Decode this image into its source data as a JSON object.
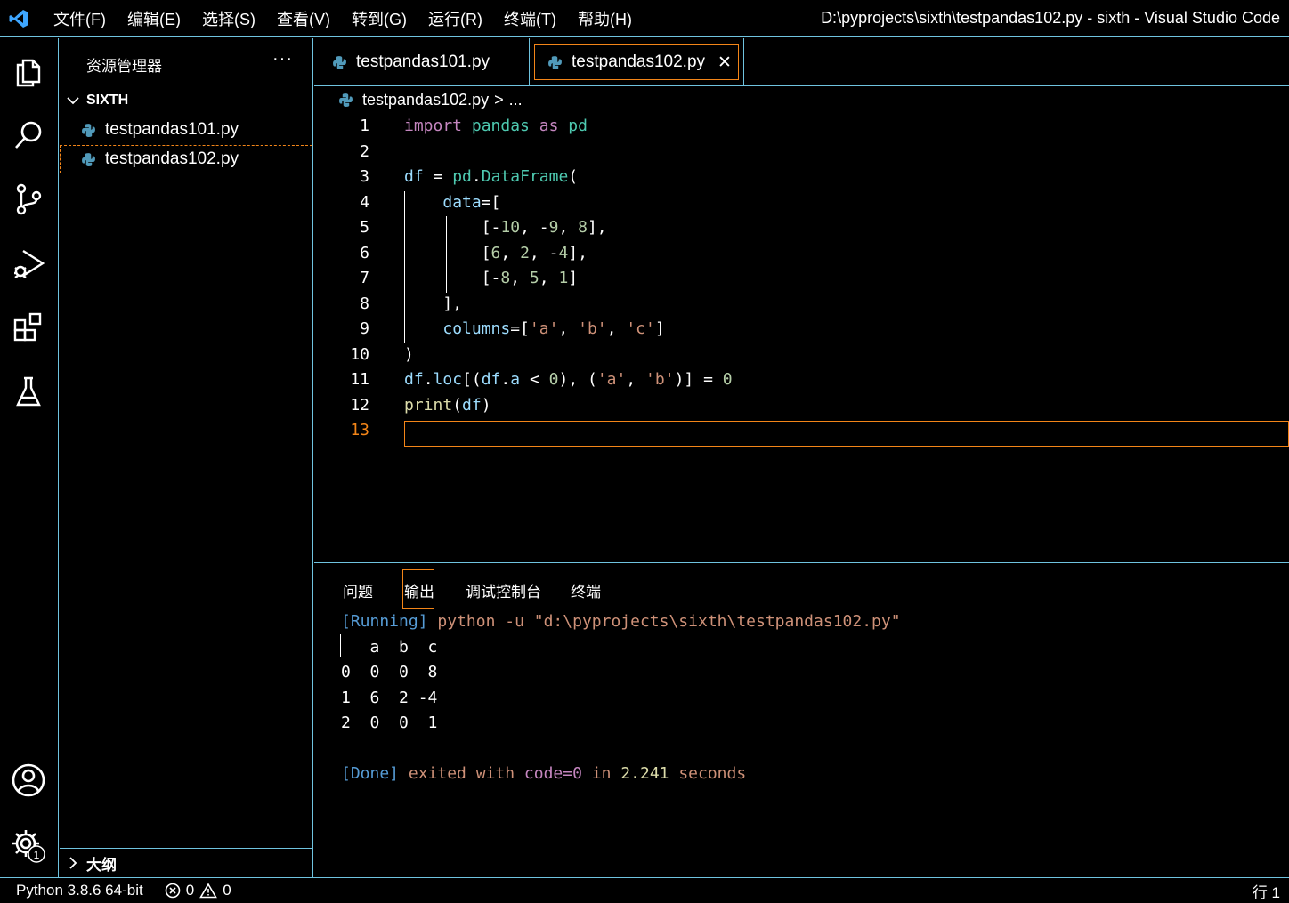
{
  "titlebar": {
    "menu": [
      "文件(F)",
      "编辑(E)",
      "选择(S)",
      "查看(V)",
      "转到(G)",
      "运行(R)",
      "终端(T)",
      "帮助(H)"
    ],
    "window_title": "D:\\pyprojects\\sixth\\testpandas102.py - sixth - Visual Studio Code"
  },
  "activitybar": {
    "icons": [
      "explorer-icon",
      "search-icon",
      "source-control-icon",
      "run-debug-icon",
      "extensions-icon",
      "testing-icon",
      "account-icon",
      "settings-gear-icon"
    ],
    "settings_badge": "1"
  },
  "sidebar": {
    "title": "资源管理器",
    "more": "···",
    "folder": "SIXTH",
    "files": [
      "testpandas101.py",
      "testpandas102.py"
    ],
    "outline": "大纲"
  },
  "tabs": {
    "items": [
      "testpandas101.py",
      "testpandas102.py"
    ],
    "close": "✕"
  },
  "breadcrumb": {
    "file": "testpandas102.py",
    "sep": ">",
    "rest": "..."
  },
  "editor": {
    "line_numbers": [
      "1",
      "2",
      "3",
      "4",
      "5",
      "6",
      "7",
      "8",
      "9",
      "10",
      "11",
      "12",
      "13"
    ]
  },
  "panel": {
    "tabs": [
      "问题",
      "输出",
      "调试控制台",
      "终端"
    ],
    "output": {
      "running_tag": "[Running]",
      "running_cmd": " python -u \"d:\\pyprojects\\sixth\\testpandas102.py\"",
      "rows": [
        "   a  b  c",
        "0  0  0  8",
        "1  6  2 -4",
        "2  0  0  1"
      ],
      "done_tag": "[Done]",
      "done_a": " exited with ",
      "done_code": "code=0",
      "done_b": " in ",
      "done_secs": "2.241",
      "done_c": " seconds"
    }
  },
  "statusbar": {
    "python": "Python 3.8.6 64-bit",
    "errors": "0",
    "warnings": "0",
    "line": "行 1"
  },
  "colors": {
    "border": "#6fc3df",
    "focus": "#f38518",
    "keyword": "#c586c0",
    "module": "#4ec9b0",
    "number": "#b5cea8",
    "string": "#ce9178"
  }
}
